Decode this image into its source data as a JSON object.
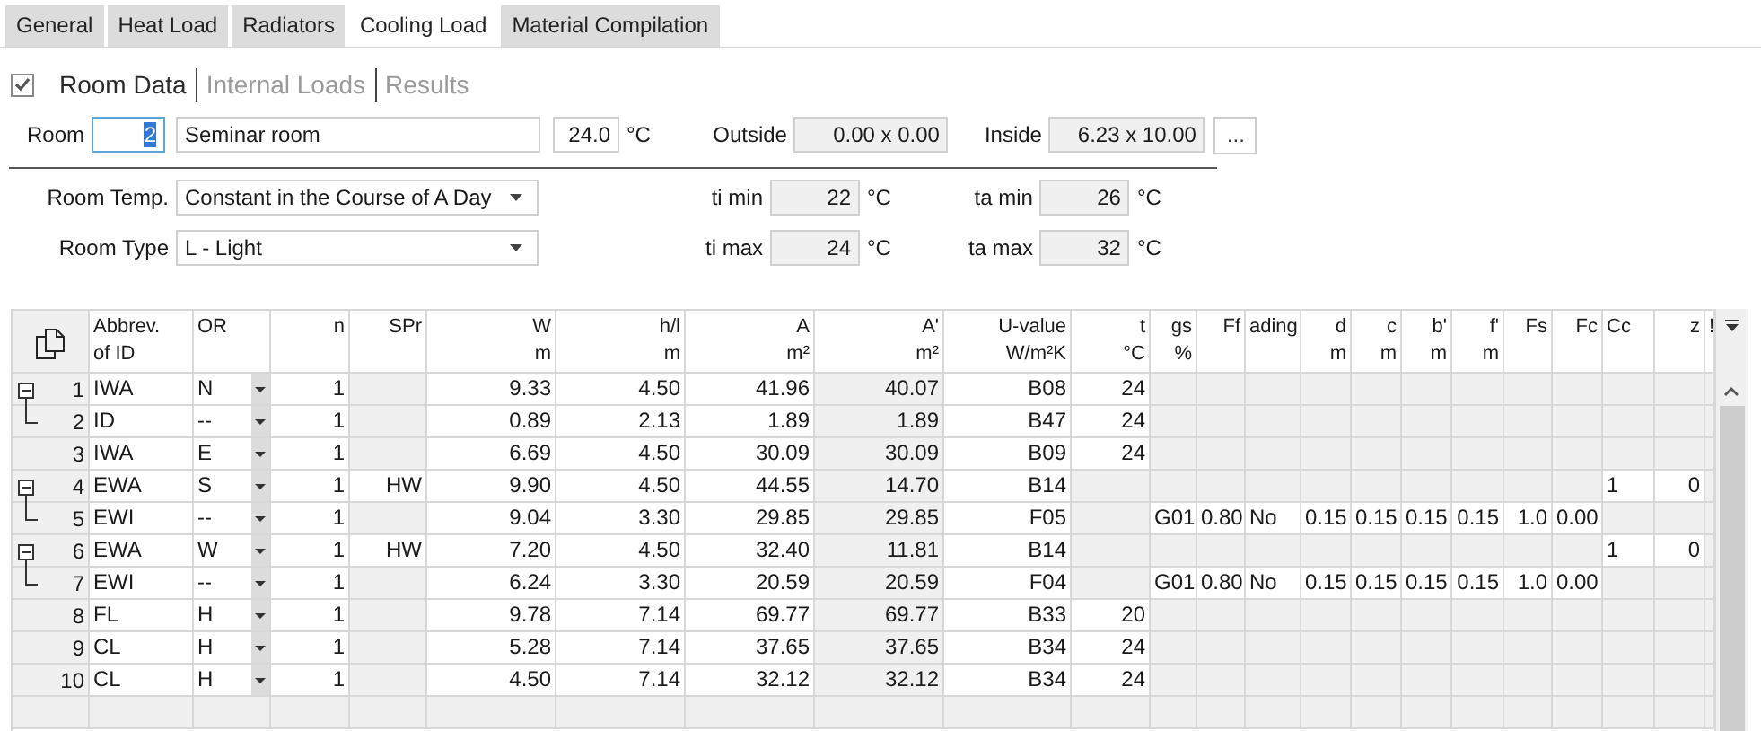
{
  "tabs": [
    {
      "label": "General",
      "selected": false
    },
    {
      "label": "Heat Load",
      "selected": false
    },
    {
      "label": "Radiators",
      "selected": false
    },
    {
      "label": "Cooling Load",
      "selected": true
    },
    {
      "label": "Material Compilation",
      "selected": false
    }
  ],
  "sections": {
    "checked": true,
    "items": [
      {
        "label": "Room Data",
        "selected": true
      },
      {
        "label": "Internal Loads",
        "selected": false
      },
      {
        "label": "Results",
        "selected": false
      }
    ]
  },
  "room": {
    "label": "Room",
    "number": "2",
    "number_highlighted": true,
    "name": "Seminar room",
    "temperature": "24.0",
    "temperature_unit": "°C",
    "outside_label": "Outside",
    "outside": "0.00 x 0.00",
    "inside_label": "Inside",
    "inside": "6.23 x 10.00",
    "more_button": "..."
  },
  "settings": [
    {
      "label": "Room Temp.",
      "value": "Constant in the Course of A Day",
      "fields": [
        {
          "label": "ti min",
          "value": "22",
          "unit": "°C"
        },
        {
          "label": "ta min",
          "value": "26",
          "unit": "°C"
        }
      ]
    },
    {
      "label": "Room Type",
      "value": "L - Light",
      "fields": [
        {
          "label": "ti max",
          "value": "24",
          "unit": "°C"
        },
        {
          "label": "ta max",
          "value": "32",
          "unit": "°C"
        }
      ]
    }
  ],
  "table": {
    "columns": [
      {
        "lines": [
          "Abbrev.",
          "of ID"
        ]
      },
      {
        "lines": [
          "OR"
        ]
      },
      {
        "lines": [
          "n"
        ]
      },
      {
        "lines": [
          "SPr"
        ]
      },
      {
        "lines": [
          "W",
          "m"
        ]
      },
      {
        "lines": [
          "h/l",
          "m"
        ]
      },
      {
        "lines": [
          "A",
          "m²"
        ]
      },
      {
        "lines": [
          "A'",
          "m²"
        ]
      },
      {
        "lines": [
          "U-value",
          "W/m²K"
        ]
      },
      {
        "lines": [
          "t",
          "°C"
        ]
      },
      {
        "lines": [
          "gs",
          "%"
        ]
      },
      {
        "lines": [
          "Ff"
        ]
      },
      {
        "lines": [
          "ading"
        ]
      },
      {
        "lines": [
          "d",
          "m"
        ]
      },
      {
        "lines": [
          "c",
          "m"
        ]
      },
      {
        "lines": [
          "b'",
          "m"
        ]
      },
      {
        "lines": [
          "f'",
          "m"
        ]
      },
      {
        "lines": [
          "Fs"
        ]
      },
      {
        "lines": [
          "Fc"
        ]
      },
      {
        "lines": [
          "Cc"
        ]
      },
      {
        "lines": [
          "z"
        ]
      },
      {
        "lines": [
          "!"
        ]
      }
    ],
    "rows": [
      {
        "number": "1",
        "kind": "wall",
        "expanded": true,
        "cells": [
          "IWA",
          "N",
          "1",
          null,
          "9.33",
          "4.50",
          "41.96",
          "40.07",
          "B08",
          "24",
          null,
          null,
          null,
          null,
          null,
          null,
          null,
          null,
          null,
          null,
          null,
          null
        ],
        "children": [
          {
            "number": "2",
            "kind": "wall",
            "cells": [
              "ID",
              "--",
              "1",
              null,
              "0.89",
              "2.13",
              "1.89",
              "1.89",
              "B47",
              "24",
              null,
              null,
              null,
              null,
              null,
              null,
              null,
              null,
              null,
              null,
              null,
              null
            ]
          }
        ]
      },
      {
        "number": "3",
        "kind": "wall",
        "cells": [
          "IWA",
          "E",
          "1",
          null,
          "6.69",
          "4.50",
          "30.09",
          "30.09",
          "B09",
          "24",
          null,
          null,
          null,
          null,
          null,
          null,
          null,
          null,
          null,
          null,
          null,
          null
        ]
      },
      {
        "number": "4",
        "kind": "exterior",
        "expanded": true,
        "cells": [
          "EWA",
          "S",
          "1",
          "HW",
          "9.90",
          "4.50",
          "44.55",
          "14.70",
          "B14",
          null,
          null,
          null,
          null,
          null,
          null,
          null,
          null,
          null,
          null,
          "1",
          "0",
          null
        ],
        "children": [
          {
            "number": "5",
            "kind": "window",
            "cells": [
              "EWI",
              "--",
              "1",
              null,
              "9.04",
              "3.30",
              "29.85",
              "29.85",
              "F05",
              null,
              "G01",
              "0.80",
              "No",
              "0.15",
              "0.15",
              "0.15",
              "0.15",
              "1.0",
              "0.00",
              null,
              null,
              null
            ]
          }
        ]
      },
      {
        "number": "6",
        "kind": "exterior",
        "expanded": true,
        "cells": [
          "EWA",
          "W",
          "1",
          "HW",
          "7.20",
          "4.50",
          "32.40",
          "11.81",
          "B14",
          null,
          null,
          null,
          null,
          null,
          null,
          null,
          null,
          null,
          null,
          "1",
          "0",
          null
        ],
        "children": [
          {
            "number": "7",
            "kind": "window",
            "cells": [
              "EWI",
              "--",
              "1",
              null,
              "6.24",
              "3.30",
              "20.59",
              "20.59",
              "F04",
              null,
              "G01",
              "0.80",
              "No",
              "0.15",
              "0.15",
              "0.15",
              "0.15",
              "1.0",
              "0.00",
              null,
              null,
              null
            ]
          }
        ]
      },
      {
        "number": "8",
        "kind": "wall",
        "cells": [
          "FL",
          "H",
          "1",
          null,
          "9.78",
          "7.14",
          "69.77",
          "69.77",
          "B33",
          "20",
          null,
          null,
          null,
          null,
          null,
          null,
          null,
          null,
          null,
          null,
          null,
          null
        ]
      },
      {
        "number": "9",
        "kind": "wall",
        "cells": [
          "CL",
          "H",
          "1",
          null,
          "5.28",
          "7.14",
          "37.65",
          "37.65",
          "B34",
          "24",
          null,
          null,
          null,
          null,
          null,
          null,
          null,
          null,
          null,
          null,
          null,
          null
        ]
      },
      {
        "number": "10",
        "kind": "wall",
        "cells": [
          "CL",
          "H",
          "1",
          null,
          "4.50",
          "7.14",
          "32.12",
          "32.12",
          "B34",
          "24",
          null,
          null,
          null,
          null,
          null,
          null,
          null,
          null,
          null,
          null,
          null,
          null
        ]
      }
    ]
  }
}
